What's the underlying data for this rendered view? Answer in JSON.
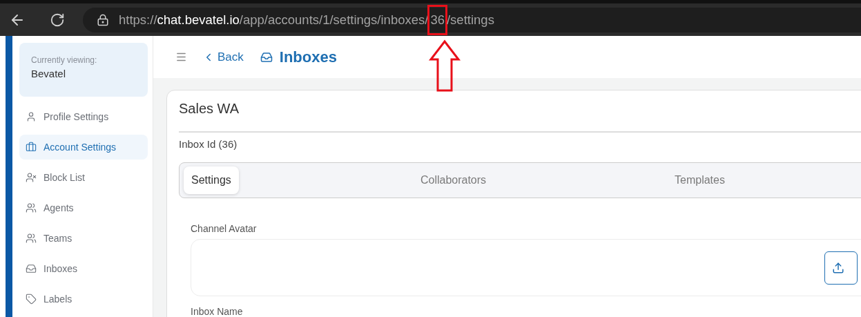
{
  "browser": {
    "url": [
      {
        "text": "https://",
        "strong": false,
        "highlighted": false
      },
      {
        "text": "chat.bevatel.io",
        "strong": true,
        "highlighted": false
      },
      {
        "text": "/app/accounts/1/settings/inboxes/",
        "strong": false,
        "highlighted": false
      },
      {
        "text": "36",
        "strong": false,
        "highlighted": true
      },
      {
        "text": "/settings",
        "strong": false,
        "highlighted": false
      }
    ]
  },
  "sidebar": {
    "account": {
      "caption": "Currently viewing:",
      "name": "Bevatel"
    },
    "items": [
      {
        "label": "Profile Settings",
        "selected": false
      },
      {
        "label": "Account Settings",
        "selected": true
      },
      {
        "label": "Block List",
        "selected": false
      },
      {
        "label": "Agents",
        "selected": false
      },
      {
        "label": "Teams",
        "selected": false
      },
      {
        "label": "Inboxes",
        "selected": false
      },
      {
        "label": "Labels",
        "selected": false
      }
    ]
  },
  "header": {
    "back": "Back",
    "title": "Inboxes"
  },
  "card": {
    "title": "Sales WA",
    "subtitle": "Inbox Id (36)",
    "tabs": [
      {
        "label": "Settings",
        "selected": true
      },
      {
        "label": "Collaborators",
        "selected": false
      },
      {
        "label": "Templates",
        "selected": false
      }
    ],
    "fields": [
      {
        "label": "Channel Avatar",
        "kind": "upload"
      },
      {
        "label": "Inbox Name",
        "kind": "label"
      }
    ]
  }
}
